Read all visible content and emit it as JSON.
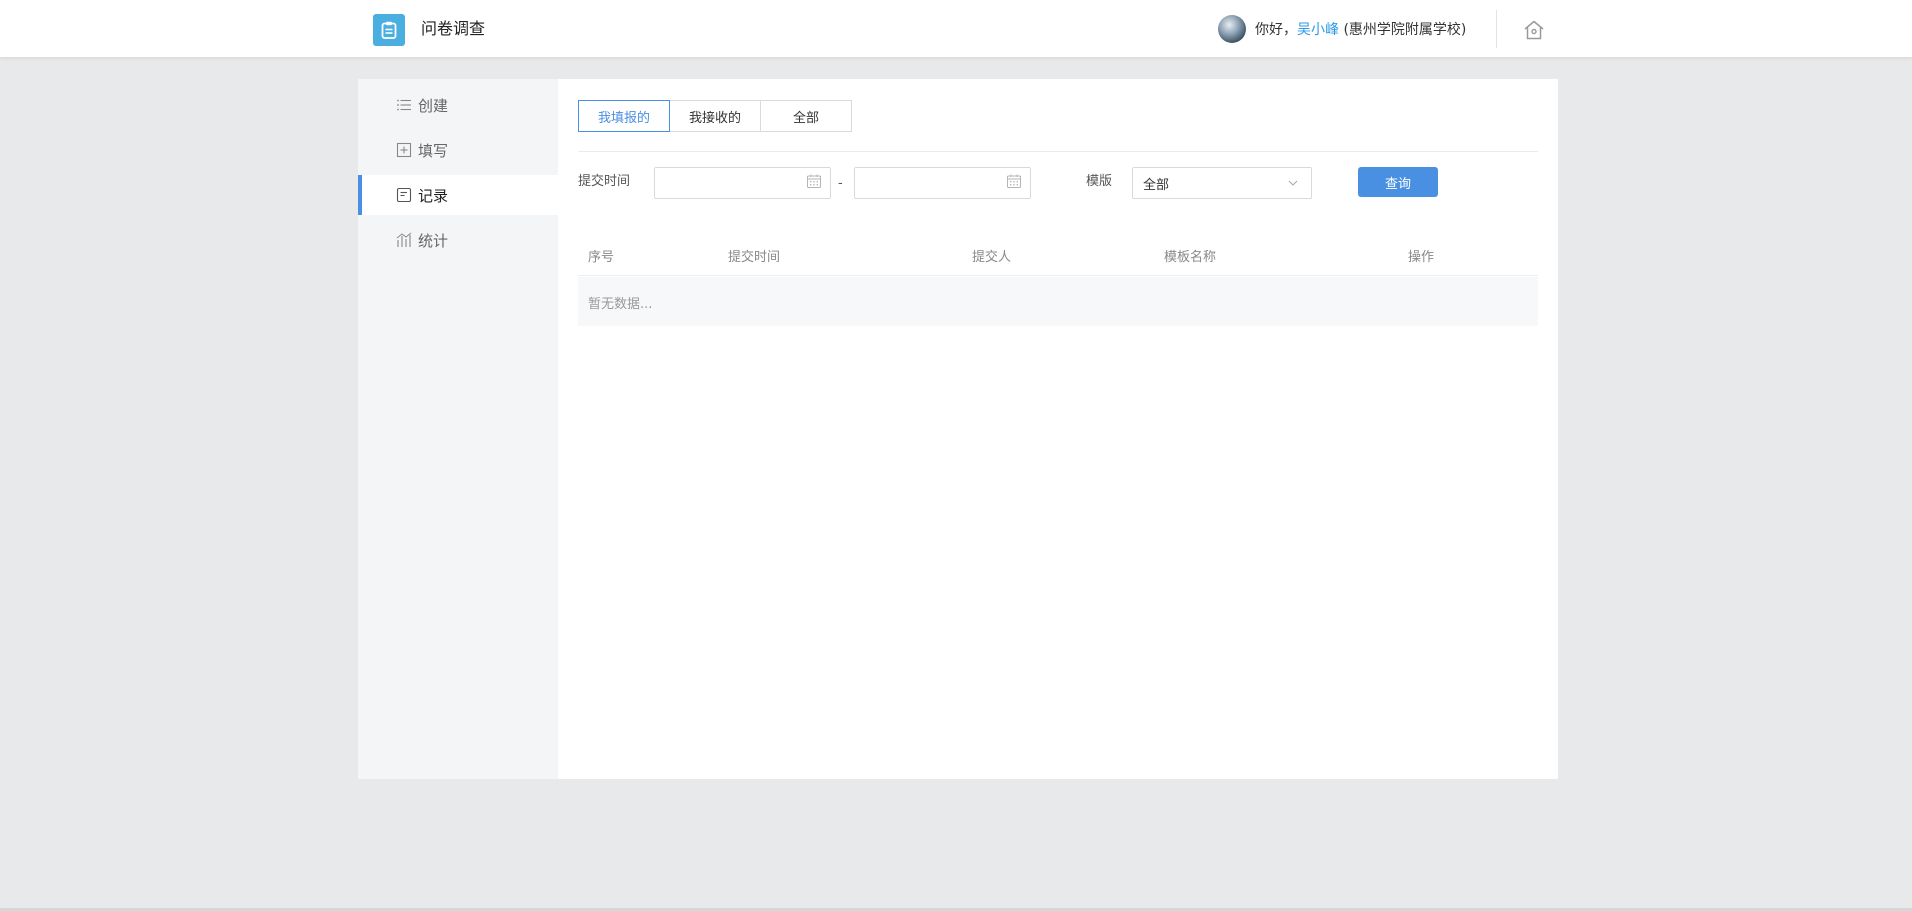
{
  "header": {
    "app_title": "问卷调查",
    "greeting": "你好，",
    "username": "吴小峰",
    "org": " (惠州学院附属学校)",
    "logo_icon": "clipboard-icon",
    "home_icon": "home-icon",
    "accent": "#4aaee0"
  },
  "sidebar": {
    "items": [
      {
        "label": "创建",
        "icon": "list-icon"
      },
      {
        "label": "填写",
        "icon": "plus-square-icon"
      },
      {
        "label": "记录",
        "icon": "record-icon",
        "active": true
      },
      {
        "label": "统计",
        "icon": "bar-chart-icon"
      }
    ]
  },
  "tabs": [
    {
      "label": "我填报的",
      "active": true
    },
    {
      "label": "我接收的"
    },
    {
      "label": "全部"
    }
  ],
  "filters": {
    "time_label": "提交时间",
    "start_value": "",
    "end_value": "",
    "separator": "-",
    "template_label": "模版",
    "template_selected": "全部",
    "query_label": "查询"
  },
  "table": {
    "headers": [
      "序号",
      "提交时间",
      "提交人",
      "模板名称",
      "操作"
    ],
    "empty_text": "暂无数据..."
  },
  "colors": {
    "primary": "#4a90e2",
    "link": "#2e9be6",
    "background": "#e8e9ea"
  }
}
